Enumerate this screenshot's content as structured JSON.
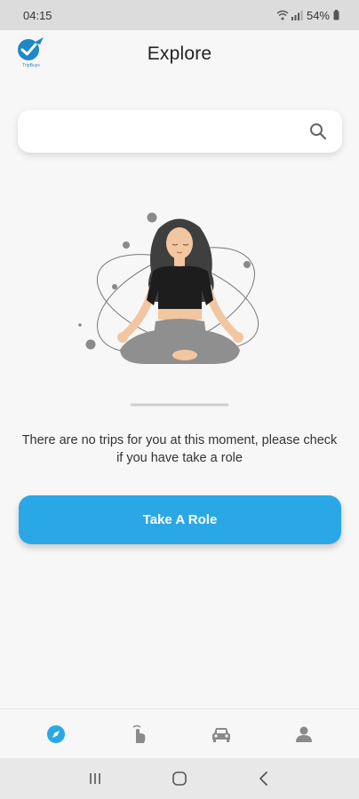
{
  "status_bar": {
    "time": "04:15",
    "battery": "54%"
  },
  "header": {
    "title": "Explore",
    "logo_text": "TripBuys"
  },
  "search": {
    "value": "",
    "placeholder": ""
  },
  "empty_state": {
    "message": "There are no trips for you at this moment, please check if you have take a role"
  },
  "actions": {
    "take_role_label": "Take A Role"
  },
  "colors": {
    "accent": "#2aa8e6",
    "nav_active": "#2aa8e6",
    "nav_inactive": "#8a8a8a"
  },
  "bottom_nav": {
    "items": [
      {
        "icon": "compass-icon",
        "active": true
      },
      {
        "icon": "tap-hand-icon",
        "active": false
      },
      {
        "icon": "car-icon",
        "active": false
      },
      {
        "icon": "person-icon",
        "active": false
      }
    ]
  },
  "system_nav": {
    "items": [
      "recent-apps-icon",
      "home-icon",
      "back-icon"
    ]
  }
}
